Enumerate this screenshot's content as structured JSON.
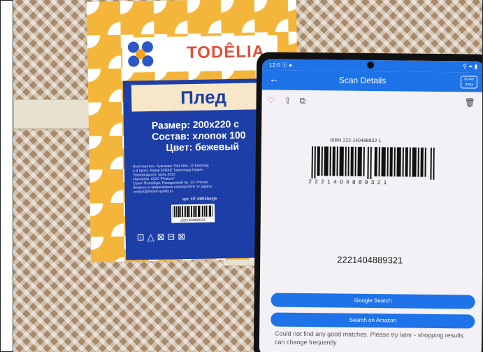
{
  "label": {
    "brand": "TODÊLIA",
    "title": "Плед",
    "size_line": "Размер: 200х220 с",
    "composition_line": "Состав: хлопок 100",
    "color_line": "Цвет: бежевый",
    "small_text": "Изготовитель: Хуанжаен Текстайл, 12 Канорад\n4-й Кросс, Карур 639002 Тамилнаду Индия\nПроизводился: июль 2023\nИмпортер: ООО \"Ремаль\"\nСанкт-Петербург, Гражданский пр., 22, Россия\nВопросы и предложения направляйте по адресу\ncontact@import-quality.ru",
    "article": "арт. HT-8893beige",
    "barcode_digits": "2221404889321",
    "care_symbols": "⊡△⊠⊟⊠"
  },
  "phone": {
    "status_left": "12:0 ⓢ ●",
    "status_right": "⚲ ⏶ ▮",
    "app_title": "Scan Details",
    "badge_text": "SCAN\nITEM",
    "isbn": "ISBN 222-140488932-1",
    "digits": "2221404889321",
    "code": "2221404889321",
    "google_button": "Google Search",
    "amazon_button": "Search on Amazon",
    "message": "Could not find any good matches. Please try later - shopping results can change frequently"
  }
}
